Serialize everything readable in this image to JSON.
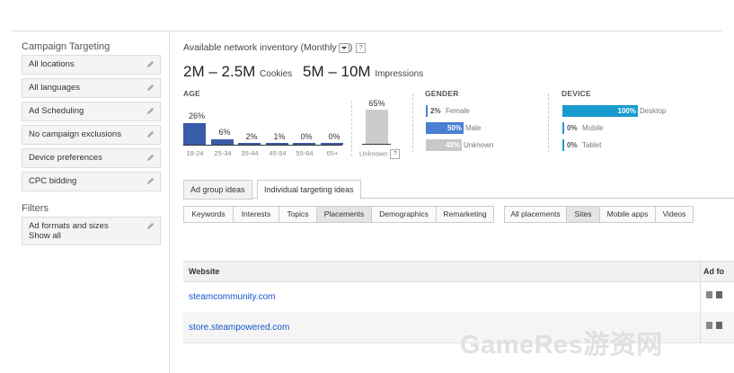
{
  "sidebar": {
    "title": "Campaign Targeting",
    "items": [
      "All locations",
      "All languages",
      "Ad Scheduling",
      "No campaign exclusions",
      "Device preferences",
      "CPC bidding"
    ],
    "filters_title": "Filters",
    "filter_item": {
      "label": "Ad formats and sizes",
      "value": "Show all"
    }
  },
  "inventory": {
    "title": "Available network inventory (Monthly",
    "cookies_value": "2M – 2.5M",
    "cookies_label": "Cookies",
    "impressions_value": "5M – 10M",
    "impressions_label": "Impressions"
  },
  "age": {
    "label": "AGE",
    "groups": [
      {
        "range": "18-24",
        "pct": "26%",
        "value": 26
      },
      {
        "range": "25-34",
        "pct": "6%",
        "value": 6
      },
      {
        "range": "35-44",
        "pct": "2%",
        "value": 2
      },
      {
        "range": "45-54",
        "pct": "1%",
        "value": 1
      },
      {
        "range": "55-64",
        "pct": "0%",
        "value": 0
      },
      {
        "range": "65+",
        "pct": "0%",
        "value": 0
      }
    ],
    "unknown": {
      "label": "Unknown",
      "pct": "65%",
      "value": 65
    }
  },
  "gender": {
    "label": "GENDER",
    "items": [
      {
        "pct": "2%",
        "name": "Female",
        "value": 2,
        "color": "#4a7fd4"
      },
      {
        "pct": "50%",
        "name": "Male",
        "value": 50,
        "color": "#4a7fd4"
      },
      {
        "pct": "48%",
        "name": "Unknown",
        "value": 48,
        "color": "#c8c8c8"
      }
    ]
  },
  "device": {
    "label": "DEVICE",
    "items": [
      {
        "pct": "100%",
        "name": "Desktop",
        "value": 100,
        "color": "#1a9bd0"
      },
      {
        "pct": "0%",
        "name": "Mobile",
        "value": 0,
        "color": "#1a9bd0"
      },
      {
        "pct": "0%",
        "name": "Tablet",
        "value": 0,
        "color": "#1a9bd0"
      }
    ]
  },
  "tabs": [
    "Ad group ideas",
    "Individual targeting ideas"
  ],
  "subtabs_left": [
    "Keywords",
    "Interests",
    "Topics",
    "Placements",
    "Demographics",
    "Remarketing"
  ],
  "subtabs_right": [
    "All placements",
    "Sites",
    "Mobile apps",
    "Videos"
  ],
  "table": {
    "col_website": "Website",
    "col_formats": "Ad fo",
    "rows": [
      "steamcommunity.com",
      "store.steampowered.com"
    ]
  },
  "watermark": "GameRes游资网"
}
